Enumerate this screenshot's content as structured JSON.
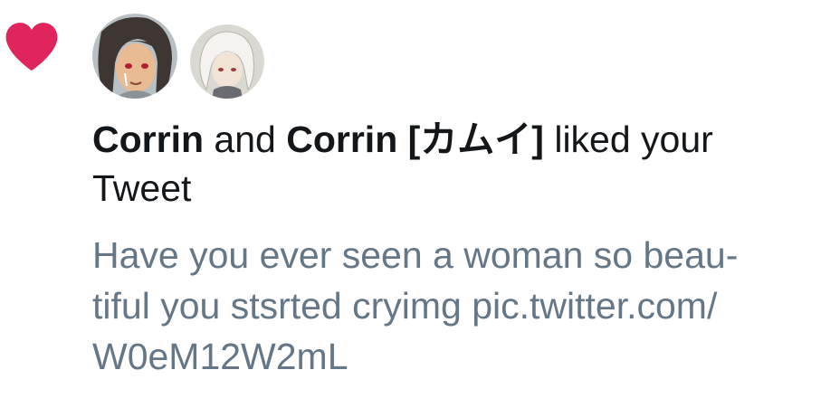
{
  "notification": {
    "icon": "heart-icon",
    "icon_color": "#e0245e",
    "users": [
      {
        "name": "Corrin",
        "avatar": "avatar-dark-hair-icon"
      },
      {
        "name": "Corrin [カムイ]",
        "avatar": "avatar-white-hair-icon"
      }
    ],
    "conjunction": "and",
    "action": "liked your Tweet",
    "tweet_lines": [
      "Have you ever seen a woman so beau-",
      "tiful you stsrted cryimg pic.twitter.com/",
      "W0eM12W2mL"
    ],
    "text_color": "#14171a",
    "secondary_color": "#657786"
  }
}
